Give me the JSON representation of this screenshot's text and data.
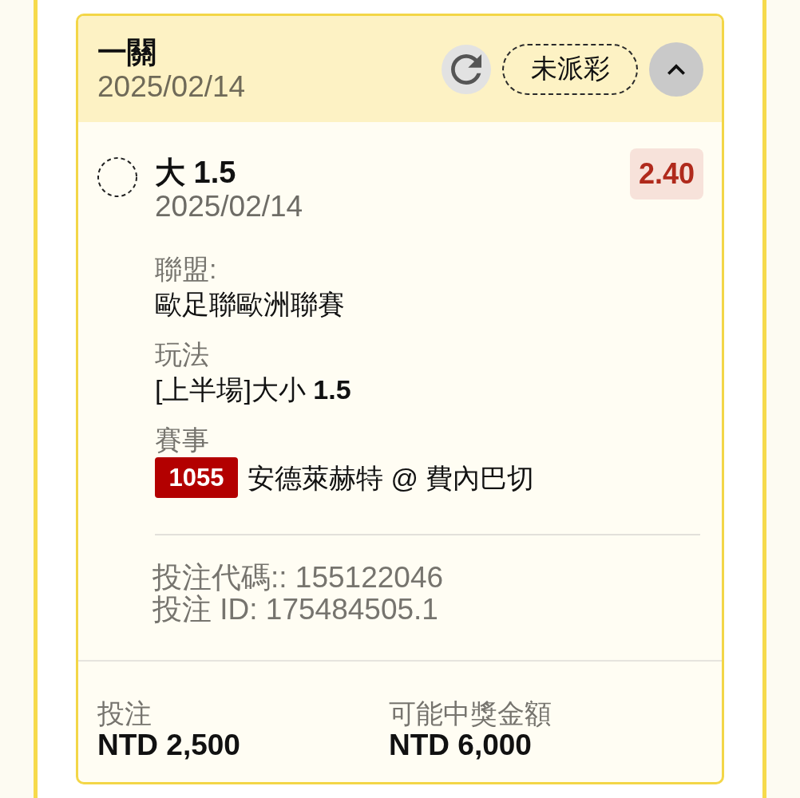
{
  "bet": {
    "title": "一關",
    "date": "2025/02/14",
    "status": "未派彩",
    "expanded": true
  },
  "selection": {
    "name": "大 1.5",
    "date": "2025/02/14",
    "odds": "2.40",
    "settled": false
  },
  "details": [
    {
      "kind": "text",
      "label": "聯盟:",
      "value": "歐足聯歐洲聯賽"
    },
    {
      "kind": "text",
      "label": "玩法",
      "value": "[上半場]大小 **1.5**"
    },
    {
      "kind": "event",
      "label": "賽事",
      "event_number": "1055",
      "value": "安德萊赫特 @ 費內巴切"
    }
  ],
  "codes": [
    "投注代碼:: 155122046",
    "投注 ID: 175484505.1"
  ],
  "summary": [
    {
      "label": "投注",
      "amount": "NTD 2,500"
    },
    {
      "label": "可能中獎金額",
      "amount": "NTD 6,000"
    }
  ]
}
